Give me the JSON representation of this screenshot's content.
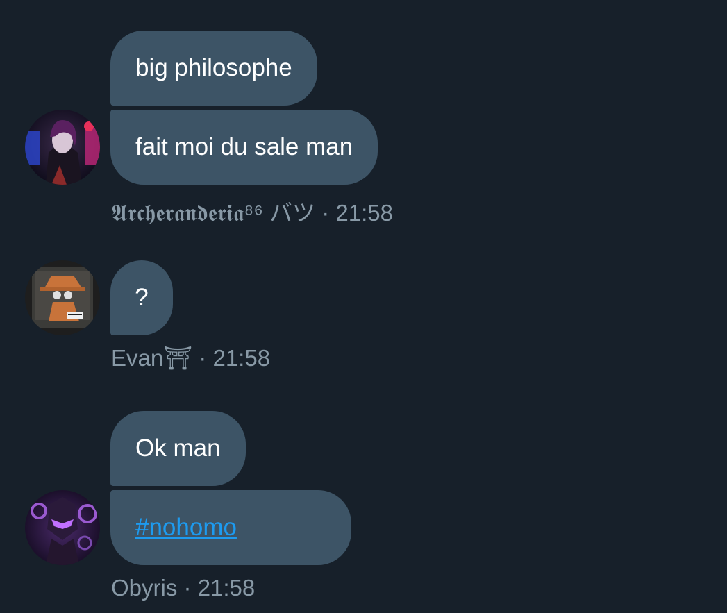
{
  "conversation": {
    "groups": [
      {
        "avatar_icon": "anime-character-avatar-icon",
        "messages": [
          "big philosophe",
          "fait moi du sale man"
        ],
        "sender": "𝕬𝖗𝖈𝖍𝖊𝖗𝖆𝖓𝖉𝖊𝖗𝖎𝖆⁸⁶ バツ",
        "time": "21:58"
      },
      {
        "avatar_icon": "album-cover-avatar-icon",
        "messages": [
          "?"
        ],
        "sender": "Evan⛩",
        "time": "21:58"
      },
      {
        "avatar_icon": "purple-robot-avatar-icon",
        "messages": [
          "Ok man",
          "#nohomo"
        ],
        "sender": "Obyris",
        "time": "21:58"
      }
    ],
    "separator": "·"
  },
  "colors": {
    "background": "#17202a",
    "bubble": "#3d5466",
    "meta_text": "#8899a6",
    "link": "#1d9bf0"
  }
}
